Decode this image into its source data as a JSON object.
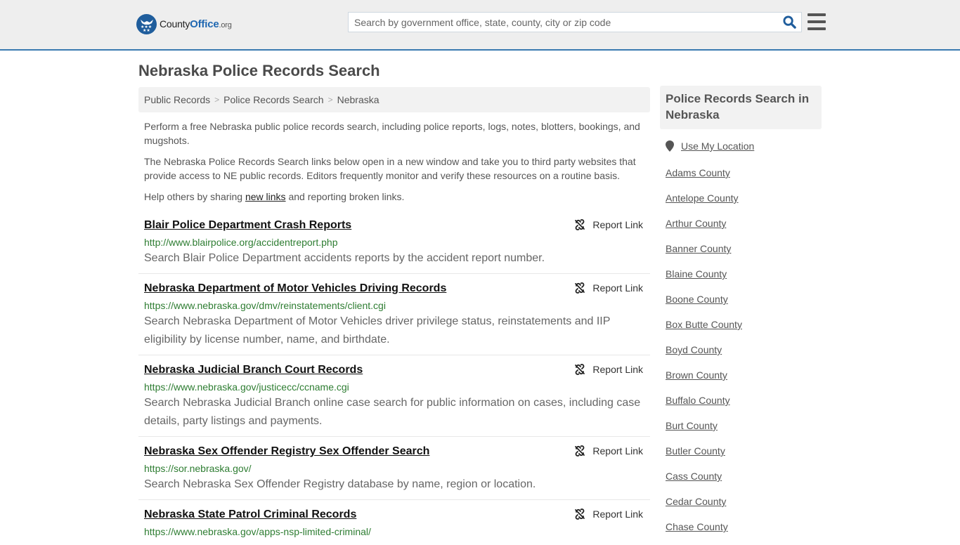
{
  "header": {
    "logo": {
      "name": "County",
      "office": "Office",
      "tld": ".org"
    },
    "search": {
      "placeholder": "Search by government office, state, county, city or zip code",
      "value": ""
    },
    "colors": {
      "brand": "#1f5d9c",
      "border": "#3a7ab0"
    }
  },
  "page": {
    "title": "Nebraska Police Records Search",
    "breadcrumb": [
      "Public Records",
      "Police Records Search",
      "Nebraska"
    ],
    "intro": [
      "Perform a free Nebraska public police records search, including police reports, logs, notes, blotters, bookings, and mugshots.",
      "The Nebraska Police Records Search links below open in a new window and take you to third party websites that provide access to NE public records. Editors frequently monitor and verify these resources on a routine basis."
    ],
    "help": {
      "before": "Help others by sharing ",
      "link": "new links",
      "after": " and reporting broken links."
    }
  },
  "results": [
    {
      "title": "Blair Police Department Crash Reports",
      "url": "http://www.blairpolice.org/accidentreport.php",
      "description": "Search Blair Police Department accidents reports by the accident report number.",
      "report_label": "Report Link"
    },
    {
      "title": "Nebraska Department of Motor Vehicles Driving Records",
      "url": "https://www.nebraska.gov/dmv/reinstatements/client.cgi",
      "description": "Search Nebraska Department of Motor Vehicles driver privilege status, reinstatements and IIP eligibility by license number, name, and birthdate.",
      "report_label": "Report Link"
    },
    {
      "title": "Nebraska Judicial Branch Court Records",
      "url": "https://www.nebraska.gov/justicecc/ccname.cgi",
      "description": "Search Nebraska Judicial Branch online case search for public information on cases, including case details, party listings and payments.",
      "report_label": "Report Link"
    },
    {
      "title": "Nebraska Sex Offender Registry Sex Offender Search",
      "url": "https://sor.nebraska.gov/",
      "description": "Search Nebraska Sex Offender Registry database by name, region or location.",
      "report_label": "Report Link"
    },
    {
      "title": "Nebraska State Patrol Criminal Records",
      "url": "https://www.nebraska.gov/apps-nsp-limited-criminal/",
      "description": "",
      "report_label": "Report Link"
    }
  ],
  "sidebar": {
    "heading": "Police Records Search in Nebraska",
    "use_location": "Use My Location",
    "counties": [
      "Adams County",
      "Antelope County",
      "Arthur County",
      "Banner County",
      "Blaine County",
      "Boone County",
      "Box Butte County",
      "Boyd County",
      "Brown County",
      "Buffalo County",
      "Burt County",
      "Butler County",
      "Cass County",
      "Cedar County",
      "Chase County"
    ]
  }
}
